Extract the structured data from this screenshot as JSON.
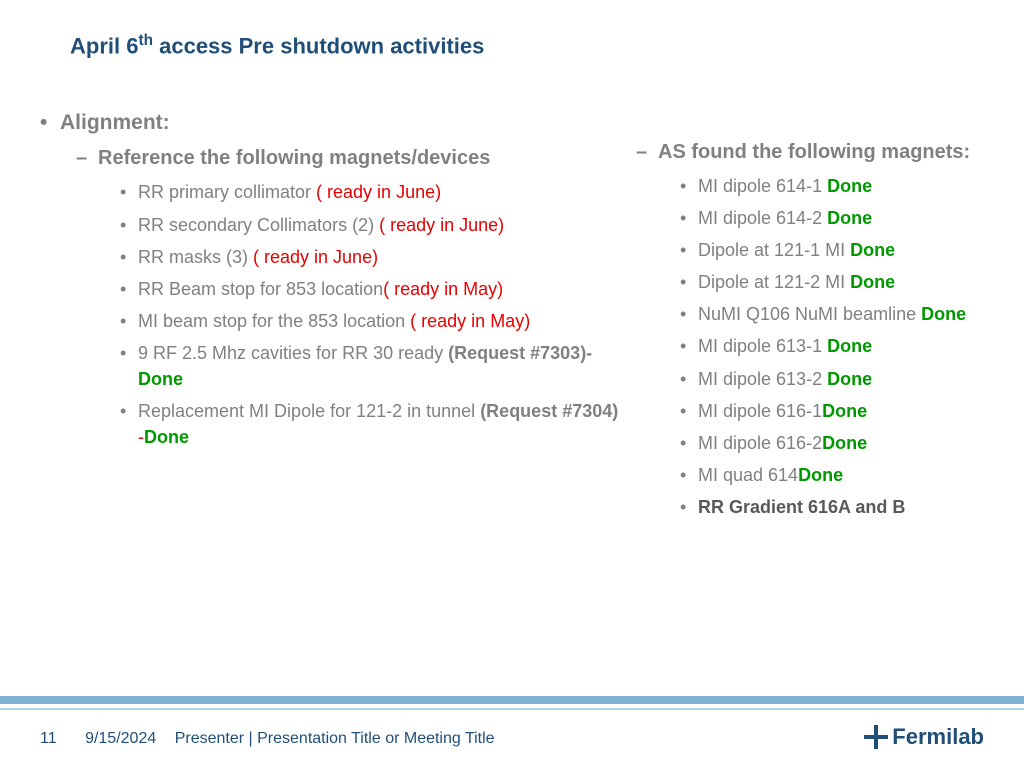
{
  "title": {
    "pre": "April 6",
    "sup": "th",
    "post": " access Pre shutdown activities"
  },
  "left": {
    "h1": "Alignment:",
    "h2": "Reference the following magnets/devices",
    "items": [
      {
        "t": "RR primary collimator ",
        "r": "( ready in June)"
      },
      {
        "t": "RR secondary Collimators (2) ",
        "r": "( ready in June)"
      },
      {
        "t": "RR masks (3) ",
        "r": "( ready in June)"
      },
      {
        "t": "RR Beam stop for 853 location",
        "r": "( ready in May)"
      },
      {
        "t": "MI beam stop for the 853 location ",
        "r": "( ready in May)"
      },
      {
        "t": "9 RF 2.5 Mhz cavities for RR 30 ready ",
        "b": "(Request #7303)-",
        "g": "Done"
      },
      {
        "t": "Replacement MI Dipole for 121-2 in tunnel ",
        "b": "(Request #7304) ",
        "dash": "-",
        "g": "Done"
      }
    ]
  },
  "right": {
    "h2": "AS found the following magnets:",
    "items": [
      {
        "t": "MI dipole 614-1 ",
        "g": "Done"
      },
      {
        "t": "MI dipole 614-2 ",
        "g": "Done"
      },
      {
        "t": "Dipole at 121-1 MI ",
        "g": "Done"
      },
      {
        "t": "Dipole at 121-2 MI ",
        "g": "Done"
      },
      {
        "t": "NuMI Q106 NuMI beamline ",
        "g": "Done"
      },
      {
        "t": "MI dipole 613-1 ",
        "g": "Done"
      },
      {
        "t": "MI dipole 613-2 ",
        "g": "Done"
      },
      {
        "t": "MI dipole 616-1",
        "g": "Done"
      },
      {
        "t": "MI dipole 616-2",
        "g": "Done"
      },
      {
        "t": "MI quad 614",
        "g": "Done"
      },
      {
        "bb": "RR Gradient 616A and B"
      }
    ]
  },
  "footer": {
    "page": "11",
    "date": "9/15/2024",
    "presenter": "Presenter | Presentation Title or Meeting Title",
    "logo": "Fermilab"
  }
}
